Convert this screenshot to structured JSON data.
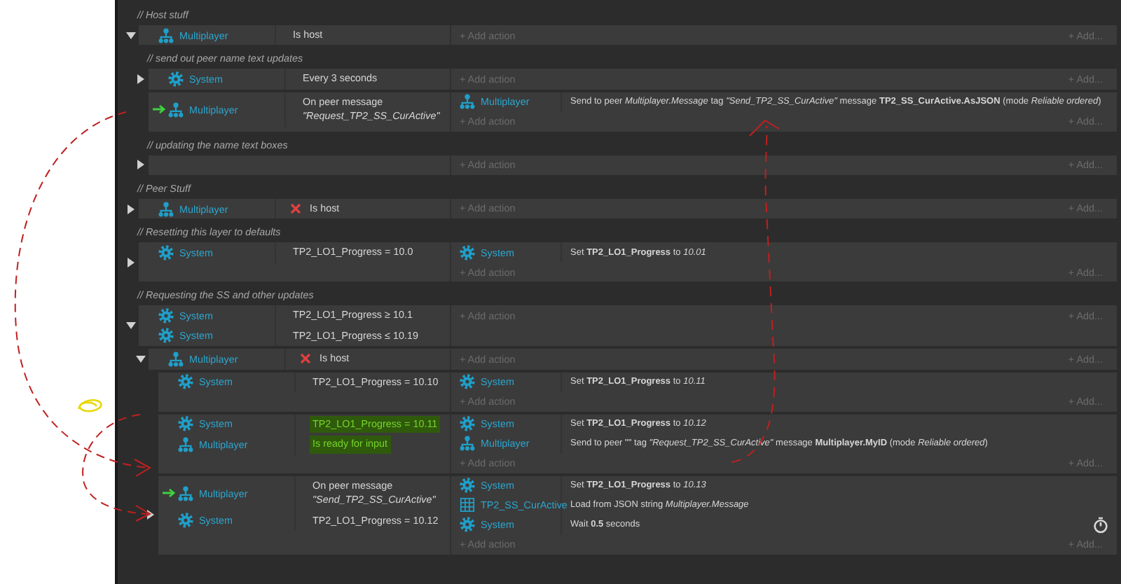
{
  "events": [
    {
      "kind": "comment",
      "text": "// Host stuff"
    },
    {
      "kind": "event",
      "expanded": true,
      "conditions": [
        {
          "kind": "multiplayer",
          "object": "Multiplayer",
          "text": "Is host",
          "trigger": false,
          "inverted": false,
          "highlighted": false
        }
      ],
      "add_action": "+ Add action",
      "add_more": "+ Add...",
      "children": [
        {
          "kind": "comment",
          "text": "// send out peer name text updates"
        },
        {
          "kind": "event",
          "expanded": false,
          "conditions": [
            {
              "kind": "system",
              "object": "System",
              "text": "Every 3 seconds",
              "trigger": false,
              "inverted": false,
              "highlighted": false
            }
          ],
          "add_action": "+ Add action",
          "add_more": "+ Add..."
        },
        {
          "kind": "event",
          "conditions": [
            {
              "kind": "multiplayer",
              "object": "Multiplayer",
              "text": "On peer message *\"Request_TP2_SS_CurActive\"*",
              "trigger": true,
              "inverted": false,
              "highlighted": false
            }
          ],
          "actions": [
            {
              "kind": "multiplayer",
              "object": "Multiplayer",
              "text": "Send to peer *Multiplayer.Message* tag *\"Send_TP2_SS_CurActive\"* message **TP2_SS_CurActive.AsJSON** (mode *Reliable ordered*)",
              "timer": false
            }
          ],
          "add_action": "+ Add action",
          "add_more": "+ Add..."
        },
        {
          "kind": "comment",
          "text": "// updating the name text boxes"
        },
        {
          "kind": "event",
          "expanded": false,
          "add_action": "+ Add action",
          "add_more": "+ Add..."
        }
      ]
    },
    {
      "kind": "comment",
      "text": "// Peer Stuff"
    },
    {
      "kind": "event",
      "expanded": false,
      "conditions": [
        {
          "kind": "multiplayer",
          "object": "Multiplayer",
          "text": "Is host",
          "trigger": false,
          "inverted": true,
          "highlighted": false
        }
      ],
      "add_action": "+ Add action",
      "add_more": "+ Add..."
    },
    {
      "kind": "comment",
      "text": "// Resetting this layer to defaults"
    },
    {
      "kind": "event",
      "expanded": false,
      "conditions": [
        {
          "kind": "system",
          "object": "System",
          "text": "TP2_LO1_Progress = 10.0",
          "trigger": false,
          "inverted": false,
          "highlighted": false
        }
      ],
      "actions": [
        {
          "kind": "system",
          "object": "System",
          "text": "Set **TP2_LO1_Progress** to *10.01*",
          "timer": false
        }
      ],
      "add_action": "+ Add action",
      "add_more": "+ Add..."
    },
    {
      "kind": "comment",
      "text": "// Requesting the SS and other updates"
    },
    {
      "kind": "event",
      "expanded": true,
      "conditions": [
        {
          "kind": "system",
          "object": "System",
          "text": "TP2_LO1_Progress ≥ 10.1",
          "trigger": false,
          "inverted": false,
          "highlighted": false
        },
        {
          "kind": "system",
          "object": "System",
          "text": "TP2_LO1_Progress ≤ 10.19",
          "trigger": false,
          "inverted": false,
          "highlighted": false
        }
      ],
      "add_action": "+ Add action",
      "add_more": "+ Add...",
      "children": [
        {
          "kind": "event",
          "expanded": true,
          "conditions": [
            {
              "kind": "multiplayer",
              "object": "Multiplayer",
              "text": "Is host",
              "trigger": false,
              "inverted": true,
              "highlighted": false
            }
          ],
          "add_action": "+ Add action",
          "add_more": "+ Add...",
          "children": [
            {
              "kind": "event",
              "conditions": [
                {
                  "kind": "system",
                  "object": "System",
                  "text": "TP2_LO1_Progress = 10.10",
                  "trigger": false,
                  "inverted": false,
                  "highlighted": false
                }
              ],
              "actions": [
                {
                  "kind": "system",
                  "object": "System",
                  "text": "Set **TP2_LO1_Progress** to *10.11*",
                  "timer": false
                }
              ],
              "add_action": "+ Add action",
              "add_more": "+ Add..."
            },
            {
              "kind": "event",
              "conditions": [
                {
                  "kind": "system",
                  "object": "System",
                  "text": "TP2_LO1_Progress = 10.11",
                  "trigger": false,
                  "inverted": false,
                  "highlighted": true
                },
                {
                  "kind": "multiplayer",
                  "object": "Multiplayer",
                  "text": "Is ready for input",
                  "trigger": false,
                  "inverted": false,
                  "highlighted": true
                }
              ],
              "actions": [
                {
                  "kind": "system",
                  "object": "System",
                  "text": "Set **TP2_LO1_Progress** to *10.12*",
                  "timer": false
                },
                {
                  "kind": "multiplayer",
                  "object": "Multiplayer",
                  "text": "Send to peer \"\" tag *\"Request_TP2_SS_CurActive\"* message **Multiplayer.MyID** (mode *Reliable ordered*)",
                  "timer": false
                }
              ],
              "add_action": "+ Add action",
              "add_more": "+ Add..."
            },
            {
              "kind": "event",
              "expanded": false,
              "conditions": [
                {
                  "kind": "multiplayer",
                  "object": "Multiplayer",
                  "text": "On peer message *\"Send_TP2_SS_CurActive\"*",
                  "trigger": true,
                  "inverted": false,
                  "highlighted": false
                },
                {
                  "kind": "system",
                  "object": "System",
                  "text": "TP2_LO1_Progress = 10.12",
                  "trigger": false,
                  "inverted": false,
                  "highlighted": false
                }
              ],
              "actions": [
                {
                  "kind": "system",
                  "object": "System",
                  "text": "Set **TP2_LO1_Progress** to *10.13*",
                  "timer": false
                },
                {
                  "kind": "array",
                  "object": "TP2_SS_CurActive",
                  "text": "Load from JSON string *Multiplayer.Message*",
                  "timer": false
                },
                {
                  "kind": "system",
                  "object": "System",
                  "text": "Wait **0.5** seconds",
                  "timer": true
                }
              ],
              "add_action": "+ Add action",
              "add_more": "+ Add..."
            }
          ]
        }
      ]
    }
  ]
}
